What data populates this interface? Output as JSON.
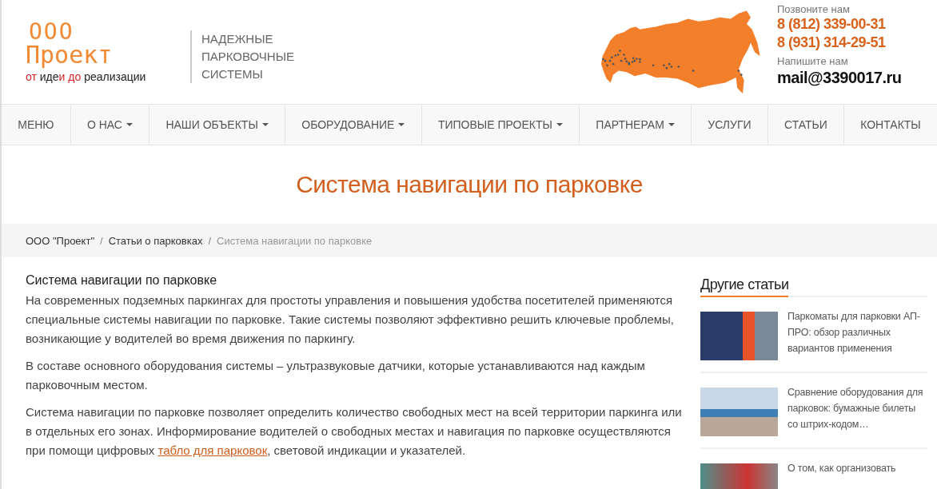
{
  "logo": {
    "line_1": "ООО",
    "line_2": "Проект",
    "tagline": [
      {
        "text": "от ",
        "accent": true
      },
      {
        "text": "иде",
        "accent": false
      },
      {
        "text": "и ",
        "accent": true
      },
      {
        "text": "до ",
        "accent": true
      },
      {
        "text": "реализации",
        "accent": false
      }
    ]
  },
  "slogan": [
    "НАДЕЖНЫЕ",
    "ПАРКОВОЧНЫЕ",
    "СИСТЕМЫ"
  ],
  "contacts": {
    "call_label": "Позвоните нам",
    "phones": [
      "8 (812) 339-00-31",
      "8 (931) 314-29-51"
    ],
    "write_label": "Напишите нам",
    "email": "mail@3390017.ru"
  },
  "nav": [
    {
      "label": "МЕНЮ",
      "dropdown": false
    },
    {
      "label": "О НАС",
      "dropdown": true
    },
    {
      "label": "НАШИ ОБЪЕКТЫ",
      "dropdown": true
    },
    {
      "label": "ОБОРУДОВАНИЕ",
      "dropdown": true
    },
    {
      "label": "ТИПОВЫЕ ПРОЕКТЫ",
      "dropdown": true
    },
    {
      "label": "ПАРТНЕРАМ",
      "dropdown": true
    },
    {
      "label": "УСЛУГИ",
      "dropdown": false
    },
    {
      "label": "СТАТЬИ",
      "dropdown": false
    },
    {
      "label": "КОНТАКТЫ",
      "dropdown": false
    }
  ],
  "page_title": "Система навигации по парковке",
  "breadcrumbs": [
    {
      "label": "ООО \"Проект\"",
      "current": false
    },
    {
      "label": "Статьи о парковках",
      "current": false
    },
    {
      "label": "Система навигации по парковке",
      "current": true
    }
  ],
  "breadcrumb_separator": "/",
  "article": {
    "heading": "Система навигации по парковке",
    "paragraphs": [
      [
        {
          "kind": "text",
          "text": "На современных подземных паркингах для простоты управления и повышения удобства посетителей применяются специальные системы навигации по парковке. Такие системы позволяют эффективно решить ключевые проблемы, возникающие у водителей во время движения по паркингу."
        }
      ],
      [
        {
          "kind": "text",
          "text": "В составе основного оборудования системы – ультразвуковые датчики, которые устанавливаются над каждым парковочным местом."
        }
      ],
      [
        {
          "kind": "text",
          "text": "Система навигации по парковке позволяет определить количество свободных мест на всей территории паркинга или в отдельных его зонах. Информирование водителей о свободных местах и навигация по парковке осуществляются при помощи цифровых "
        },
        {
          "kind": "link",
          "text": "табло для парковок"
        },
        {
          "kind": "text",
          "text": ", световой индикации и указателей."
        }
      ]
    ]
  },
  "sidebar": {
    "heading": "Другие статьи",
    "articles": [
      {
        "title": "Паркоматы для парковки АП-ПРО: обзор различных вариантов применения"
      },
      {
        "title": "Сравнение оборудования для парковок: бумажные билеты со штрих-кодом…"
      },
      {
        "title": "О том, как организовать"
      }
    ]
  }
}
